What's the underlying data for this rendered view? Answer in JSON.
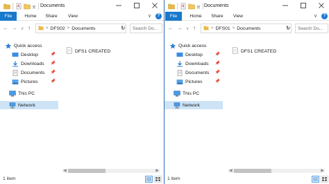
{
  "windows": [
    {
      "id": "left",
      "title": "Documents",
      "tabs": [
        "File",
        "Home",
        "Share",
        "View"
      ],
      "path": [
        "DFS02",
        "Documents"
      ],
      "search_placeholder": "Search Do...",
      "nav": [
        {
          "label": "Quick access",
          "icon": "star-icon"
        },
        {
          "label": "Desktop",
          "icon": "desktop-icon",
          "pinned": true
        },
        {
          "label": "Downloads",
          "icon": "downloads-icon",
          "pinned": true
        },
        {
          "label": "Documents",
          "icon": "documents-icon",
          "pinned": true
        },
        {
          "label": "Pictures",
          "icon": "pictures-icon",
          "pinned": true
        },
        {
          "label": "This PC",
          "icon": "computer-icon"
        },
        {
          "label": "Network",
          "icon": "network-icon",
          "selected": true
        }
      ],
      "files": [
        {
          "name": "DFS1 CREATED",
          "icon": "text-file-icon"
        }
      ],
      "status": "1 item"
    },
    {
      "id": "right",
      "title": "Documents",
      "tabs": [
        "File",
        "Home",
        "Share",
        "View"
      ],
      "path": [
        "DFS01",
        "Documents"
      ],
      "search_placeholder": "Search Do...",
      "nav": [
        {
          "label": "Quick access",
          "icon": "star-icon"
        },
        {
          "label": "Desktop",
          "icon": "desktop-icon",
          "pinned": true
        },
        {
          "label": "Downloads",
          "icon": "downloads-icon",
          "pinned": true
        },
        {
          "label": "Documents",
          "icon": "documents-icon",
          "pinned": true
        },
        {
          "label": "Pictures",
          "icon": "pictures-icon",
          "pinned": true
        },
        {
          "label": "This PC",
          "icon": "computer-icon"
        },
        {
          "label": "Network",
          "icon": "network-icon",
          "selected": true
        }
      ],
      "files": [
        {
          "name": "DFS1 CREATED",
          "icon": "text-file-icon"
        }
      ],
      "status": "1 item"
    }
  ],
  "colors": {
    "accent": "#1979ca",
    "selection": "#cde4f7",
    "folder": "#e8b94a",
    "window_border": "#2b6cb8"
  }
}
